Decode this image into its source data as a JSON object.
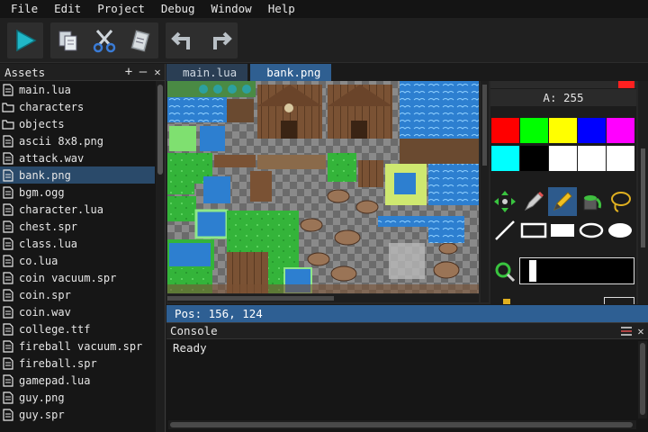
{
  "menu": [
    "File",
    "Edit",
    "Project",
    "Debug",
    "Window",
    "Help"
  ],
  "toolbar": {
    "buttons": [
      "play-icon",
      "copy-icon",
      "cut-icon",
      "paste-icon",
      "undo-icon",
      "redo-icon"
    ]
  },
  "assets": {
    "title": "Assets",
    "add": "+",
    "collapse": "—",
    "close": "✕",
    "items": [
      {
        "name": "main.lua",
        "icon": "file-icon"
      },
      {
        "name": "characters",
        "icon": "folder-icon"
      },
      {
        "name": "objects",
        "icon": "folder-icon"
      },
      {
        "name": "ascii 8x8.png",
        "icon": "file-icon"
      },
      {
        "name": "attack.wav",
        "icon": "file-icon"
      },
      {
        "name": "bank.png",
        "icon": "file-icon",
        "selected": true
      },
      {
        "name": "bgm.ogg",
        "icon": "file-icon"
      },
      {
        "name": "character.lua",
        "icon": "file-icon"
      },
      {
        "name": "chest.spr",
        "icon": "file-icon"
      },
      {
        "name": "class.lua",
        "icon": "file-icon"
      },
      {
        "name": "co.lua",
        "icon": "file-icon"
      },
      {
        "name": "coin vacuum.spr",
        "icon": "file-icon"
      },
      {
        "name": "coin.spr",
        "icon": "file-icon"
      },
      {
        "name": "coin.wav",
        "icon": "file-icon"
      },
      {
        "name": "college.ttf",
        "icon": "file-icon"
      },
      {
        "name": "fireball vacuum.spr",
        "icon": "file-icon"
      },
      {
        "name": "fireball.spr",
        "icon": "file-icon"
      },
      {
        "name": "gamepad.lua",
        "icon": "file-icon"
      },
      {
        "name": "guy.png",
        "icon": "file-icon"
      },
      {
        "name": "guy.spr",
        "icon": "file-icon"
      }
    ]
  },
  "tabs": [
    {
      "label": "main.lua",
      "active": false
    },
    {
      "label": "bank.png",
      "active": true
    }
  ],
  "palette": {
    "alpha_label": "A: 255",
    "colors": [
      "#ff0000",
      "#00ff00",
      "#ffff00",
      "#0000ff",
      "#ff00ff",
      "#00ffff",
      "#000000",
      "#ffffff",
      "#ffffff",
      "#ffffff"
    ],
    "tools": [
      "move-icon",
      "pencil-icon",
      "brush-icon",
      "fill-bucket-icon",
      "lasso-icon",
      "line-icon",
      "rect-outline-icon",
      "rect-filled-icon",
      "ellipse-outline-icon",
      "ellipse-filled-icon"
    ],
    "active_tool": "brush-icon"
  },
  "status": {
    "text": "Pos: 156, 124"
  },
  "console": {
    "title": "Console",
    "output": "Ready",
    "clear": "clear-icon",
    "close": "✕"
  }
}
